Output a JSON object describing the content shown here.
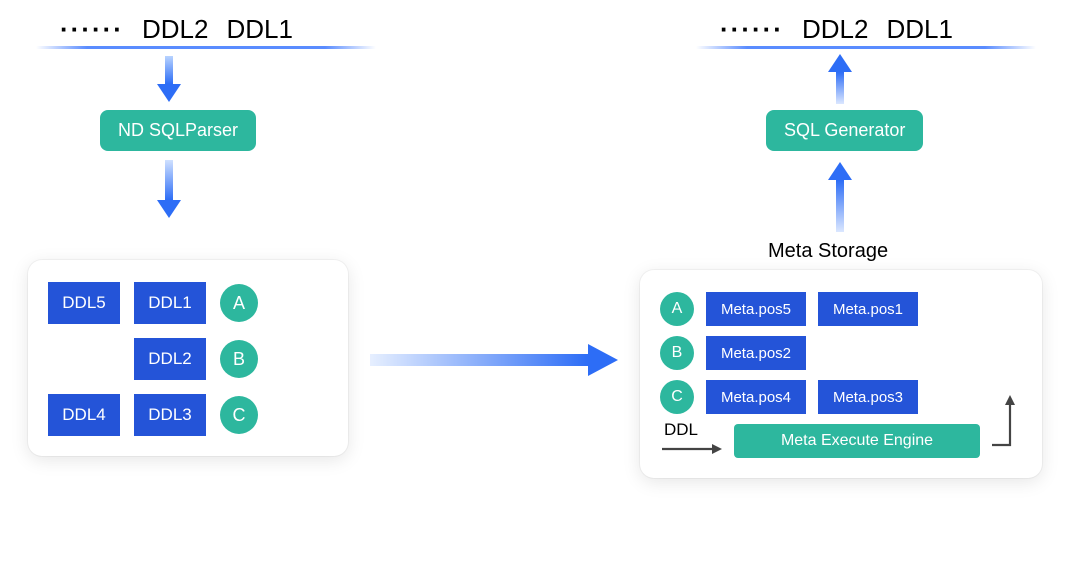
{
  "streams": {
    "dots": "······",
    "ddl2": "DDL2",
    "ddl1": "DDL1"
  },
  "left": {
    "parser": "ND SQLParser",
    "card": {
      "ddl5": "DDL5",
      "ddl1": "DDL1",
      "ddl2": "DDL2",
      "ddl4": "DDL4",
      "ddl3": "DDL3",
      "a": "A",
      "b": "B",
      "c": "C"
    }
  },
  "right": {
    "generator": "SQL Generator",
    "storage_label": "Meta Storage",
    "rows": {
      "a": {
        "label": "A",
        "m1": "Meta.pos5",
        "m2": "Meta.pos1"
      },
      "b": {
        "label": "B",
        "m1": "Meta.pos2"
      },
      "c": {
        "label": "C",
        "m1": "Meta.pos4",
        "m2": "Meta.pos3"
      }
    },
    "ddl_label": "DDL",
    "engine": "Meta Execute Engine"
  }
}
